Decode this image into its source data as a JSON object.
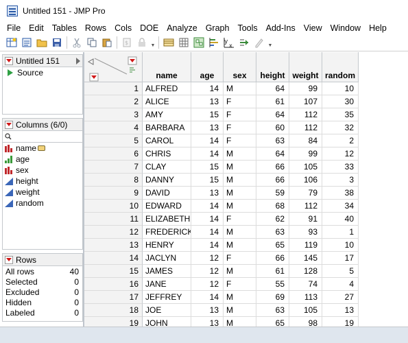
{
  "window": {
    "title": "Untitled 151 - JMP Pro"
  },
  "menu": [
    "File",
    "Edit",
    "Tables",
    "Rows",
    "Cols",
    "DOE",
    "Analyze",
    "Graph",
    "Tools",
    "Add-Ins",
    "View",
    "Window",
    "Help"
  ],
  "toolbar": [
    "new-data-table-icon",
    "new-journal-icon",
    "open-folder-icon",
    "save-icon",
    "cut-icon",
    "copy-icon",
    "paste-icon",
    "scripts-icon",
    "lock-icon",
    "data-table-icon",
    "grid-icon",
    "window-list-icon",
    "distribution-icon",
    "fit-y-by-x-icon",
    "fit-model-icon",
    "annotate-icon"
  ],
  "left_panel": {
    "table_name": "Untitled 151",
    "source_label": "Source",
    "columns_header": "Columns (6/0)",
    "columns": [
      {
        "name": "name",
        "type": "nominal",
        "labeled": true
      },
      {
        "name": "age",
        "type": "ordinal"
      },
      {
        "name": "sex",
        "type": "nominal"
      },
      {
        "name": "height",
        "type": "continuous"
      },
      {
        "name": "weight",
        "type": "continuous"
      },
      {
        "name": "random",
        "type": "continuous"
      }
    ],
    "rows_header": "Rows",
    "rows_stats": [
      {
        "label": "All rows",
        "value": "40"
      },
      {
        "label": "Selected",
        "value": "0"
      },
      {
        "label": "Excluded",
        "value": "0"
      },
      {
        "label": "Hidden",
        "value": "0"
      },
      {
        "label": "Labeled",
        "value": "0"
      }
    ]
  },
  "grid": {
    "columns": [
      "name",
      "age",
      "sex",
      "height",
      "weight",
      "random"
    ],
    "rows": [
      [
        "1",
        "ALFRED",
        "14",
        "M",
        "64",
        "99",
        "10"
      ],
      [
        "2",
        "ALICE",
        "13",
        "F",
        "61",
        "107",
        "30"
      ],
      [
        "3",
        "AMY",
        "15",
        "F",
        "64",
        "112",
        "35"
      ],
      [
        "4",
        "BARBARA",
        "13",
        "F",
        "60",
        "112",
        "32"
      ],
      [
        "5",
        "CAROL",
        "14",
        "F",
        "63",
        "84",
        "2"
      ],
      [
        "6",
        "CHRIS",
        "14",
        "M",
        "64",
        "99",
        "12"
      ],
      [
        "7",
        "CLAY",
        "15",
        "M",
        "66",
        "105",
        "33"
      ],
      [
        "8",
        "DANNY",
        "15",
        "M",
        "66",
        "106",
        "3"
      ],
      [
        "9",
        "DAVID",
        "13",
        "M",
        "59",
        "79",
        "38"
      ],
      [
        "10",
        "EDWARD",
        "14",
        "M",
        "68",
        "112",
        "34"
      ],
      [
        "11",
        "ELIZABETH",
        "14",
        "F",
        "62",
        "91",
        "40"
      ],
      [
        "12",
        "FREDERICK",
        "14",
        "M",
        "63",
        "93",
        "1"
      ],
      [
        "13",
        "HENRY",
        "14",
        "M",
        "65",
        "119",
        "10"
      ],
      [
        "14",
        "JACLYN",
        "12",
        "F",
        "66",
        "145",
        "17"
      ],
      [
        "15",
        "JAMES",
        "12",
        "M",
        "61",
        "128",
        "5"
      ],
      [
        "16",
        "JANE",
        "12",
        "F",
        "55",
        "74",
        "4"
      ],
      [
        "17",
        "JEFFREY",
        "14",
        "M",
        "69",
        "113",
        "27"
      ],
      [
        "18",
        "JOE",
        "13",
        "M",
        "63",
        "105",
        "13"
      ],
      [
        "19",
        "JOHN",
        "13",
        "M",
        "65",
        "98",
        "19"
      ]
    ]
  },
  "colors": {
    "red_triangle": "#d01818",
    "status_bar": "#dfe6ee",
    "header_bg": "#f3f3f3"
  }
}
